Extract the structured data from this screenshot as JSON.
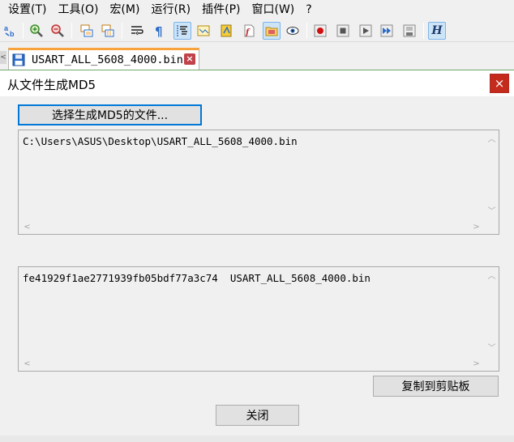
{
  "menu": {
    "items": [
      "设置(T)",
      "工具(O)",
      "宏(M)",
      "运行(R)",
      "插件(P)",
      "窗口(W)",
      "?"
    ]
  },
  "toolbar": {
    "buttons": [
      "replace-icon",
      "zoom-in-icon",
      "zoom-out-icon",
      "sync-vertical-icon",
      "sync-horizontal-icon",
      "word-wrap-icon",
      "show-all-chars-icon",
      "indent-guide-icon",
      "doc-map-icon",
      "function-list-icon",
      "user-lang-icon",
      "folder-workspace-icon",
      "monitoring-icon",
      "record-macro-icon",
      "stop-record-icon",
      "play-macro-icon",
      "run-macro-multiple-icon",
      "save-macro-icon",
      "hex-editor-icon"
    ],
    "hex_label": "H"
  },
  "tabs": [
    {
      "label": "USART_ALL_5608_4000.bin",
      "active": true,
      "close": "×"
    }
  ],
  "tab_scroll_arrow": "<",
  "dialog": {
    "title": "从文件生成MD5",
    "close_glyph": "×",
    "choose_button": "选择生成MD5的文件...",
    "file_path": "C:\\Users\\ASUS\\Desktop\\USART_ALL_5608_4000.bin",
    "md5_result": "fe41929f1ae2771939fb05bdf77a3c74  USART_ALL_5608_4000.bin",
    "copy_button": "复制到剪贴板",
    "close_button": "关闭"
  },
  "scroll_glyphs": {
    "up": "︿",
    "down": "﹀",
    "left": "<",
    "right": ">"
  },
  "colors": {
    "tab_accent": "#f8a23b",
    "close_red": "#c42b1c",
    "focus_blue": "#0078d7",
    "active_tool_bg": "#cde4f7"
  }
}
